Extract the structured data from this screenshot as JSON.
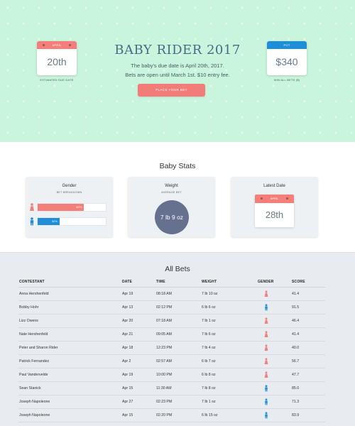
{
  "hero": {
    "title": "BABY RIDER 2017",
    "line1": "The baby's due date is April 20th, 2017.",
    "line2": "Bets are open until March 1st. $10 entry fee.",
    "button_label": "PLACE YOUR BET",
    "due_card": {
      "header": "APRIL",
      "value": "20th",
      "caption": "ESTIMATED DUE DATE"
    },
    "pot_card": {
      "header": "POT",
      "value": "$340",
      "caption": "WIN ALL BETS ($)"
    },
    "colors": {
      "background": "#c8f5dc",
      "accent_red": "#f47e7a",
      "accent_blue": "#1e8fd6"
    }
  },
  "stats": {
    "title": "Baby Stats",
    "gender": {
      "title": "Gender",
      "subtitle": "BET BREAKDOWN",
      "girl_percent": 68,
      "girl_label": "68%",
      "boy_percent": 32,
      "boy_label": "32%"
    },
    "weight": {
      "title": "Weight",
      "subtitle": "AVERAGE BET",
      "value": "7 lb 9 oz"
    },
    "latest_date": {
      "title": "Latest Date",
      "header": "APRIL",
      "value": "28th"
    }
  },
  "bets": {
    "title": "All Bets",
    "columns": [
      "CONTESTANT",
      "DATE",
      "TIME",
      "WEIGHT",
      "GENDER",
      "SCORE"
    ],
    "rows": [
      {
        "name": "Anna Hershenfeld",
        "date": "Apr 19",
        "time": "08:18 AM",
        "weight": "7 lb 10 oz",
        "gender": "girl",
        "score": "41.4"
      },
      {
        "name": "Bobby Hohr",
        "date": "Apr 13",
        "time": "02:12 PM",
        "weight": "6 lb 6 oz",
        "gender": "boy",
        "score": "91.5"
      },
      {
        "name": "Lizz Owens",
        "date": "Apr 20",
        "time": "07:18 AM",
        "weight": "7 lb 1 oz",
        "gender": "girl",
        "score": "46.4"
      },
      {
        "name": "Nate Hershenfeld",
        "date": "Apr 21",
        "time": "09:05 AM",
        "weight": "7 lb 6 oz",
        "gender": "girl",
        "score": "41.4"
      },
      {
        "name": "Peter and Sharon Rider",
        "date": "Apr 18",
        "time": "12:23 PM",
        "weight": "7 lb 4 oz",
        "gender": "girl",
        "score": "40.0"
      },
      {
        "name": "Patrick Fernandez",
        "date": "Apr 2",
        "time": "02:57 AM",
        "weight": "6 lb 7 oz",
        "gender": "girl",
        "score": "56.7"
      },
      {
        "name": "Paul Vandervelde",
        "date": "Apr 19",
        "time": "10:00 PM",
        "weight": "6 lb 8 oz",
        "gender": "girl",
        "score": "47.7"
      },
      {
        "name": "Sean Stanick",
        "date": "Apr 15",
        "time": "11:30 AM",
        "weight": "7 lb 8 oz",
        "gender": "boy",
        "score": "85.0"
      },
      {
        "name": "Joseph Napoleone",
        "date": "Apr 27",
        "time": "02:23 PM",
        "weight": "7 lb 1 oz",
        "gender": "boy",
        "score": "71.3"
      },
      {
        "name": "Joseph Napoleone",
        "date": "Apr 15",
        "time": "02:20 PM",
        "weight": "6 lb 15 oz",
        "gender": "boy",
        "score": "83.9"
      }
    ]
  }
}
